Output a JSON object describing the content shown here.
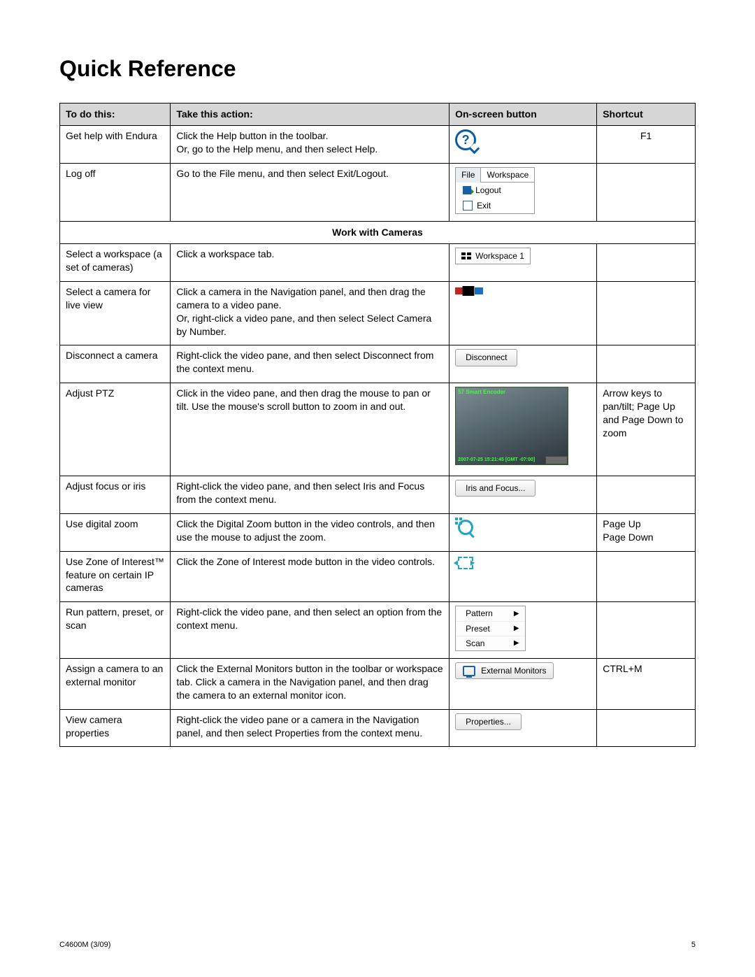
{
  "title": "Quick Reference",
  "headers": {
    "todo": "To do this:",
    "action": "Take this action:",
    "button": "On-screen button",
    "shortcut": "Shortcut"
  },
  "rows": {
    "help": {
      "todo": "Get help with Endura",
      "action": "Click the Help button in the toolbar.\nOr, go to the Help menu, and then select Help.",
      "shortcut": "F1"
    },
    "logoff": {
      "todo": "Log off",
      "action": "Go to the File menu, and then select Exit/Logout.",
      "menu_file": "File",
      "menu_workspace": "Workspace",
      "menu_logout": "Logout",
      "menu_exit": "Exit"
    },
    "section1": "Work with Cameras",
    "workspace": {
      "todo": "Select a workspace (a set of cameras)",
      "action": "Click a workspace tab.",
      "chip": "Workspace 1"
    },
    "selectcam": {
      "todo": "Select a camera for live view",
      "action": "Click a camera in the Navigation panel, and then drag the camera to a video pane.\nOr, right-click a video pane, and then select Select Camera by Number."
    },
    "disconnect": {
      "todo": "Disconnect a camera",
      "action": "Right-click the video pane, and then select Disconnect from the context menu.",
      "btn": "Disconnect"
    },
    "ptz": {
      "todo": "Adjust PTZ",
      "action": "Click in the video pane, and then drag the mouse to pan or tilt. Use the mouse's scroll button to zoom in and out.",
      "shortcut": "Arrow keys to pan/tilt; Page Up and Page Down to zoom",
      "overlay_top": "57 Smart Encoder",
      "overlay_bot": "2007-07-25 15:21:45 [GMT -07:00]"
    },
    "focus": {
      "todo": "Adjust focus or iris",
      "action": "Right-click the video pane, and then select Iris and Focus from the context menu.",
      "btn": "Iris and Focus..."
    },
    "dzoom": {
      "todo": "Use digital zoom",
      "action": "Click the Digital Zoom button in the video controls, and then use the mouse to adjust the zoom.",
      "shortcut": "Page Up\nPage Down"
    },
    "zoi": {
      "todo": "Use Zone of Interest™ feature on certain IP cameras",
      "action": "Click the Zone of Interest mode button in the video controls."
    },
    "pattern": {
      "todo": "Run pattern, preset, or scan",
      "action": "Right-click the video pane, and then select an option from the context menu.",
      "m1": "Pattern",
      "m2": "Preset",
      "m3": "Scan"
    },
    "extmon": {
      "todo": "Assign a camera to an external monitor",
      "action": "Click the External Monitors button in the toolbar or workspace tab. Click a camera in the Navigation panel, and then drag the camera to an external monitor icon.",
      "btn": "External Monitors",
      "shortcut": "CTRL+M"
    },
    "props": {
      "todo": "View camera properties",
      "action": "Right-click the video pane or a camera in the Navigation panel, and then select Properties from the context menu.",
      "btn": "Properties..."
    }
  },
  "footer": {
    "left": "C4600M (3/09)",
    "right": "5"
  }
}
